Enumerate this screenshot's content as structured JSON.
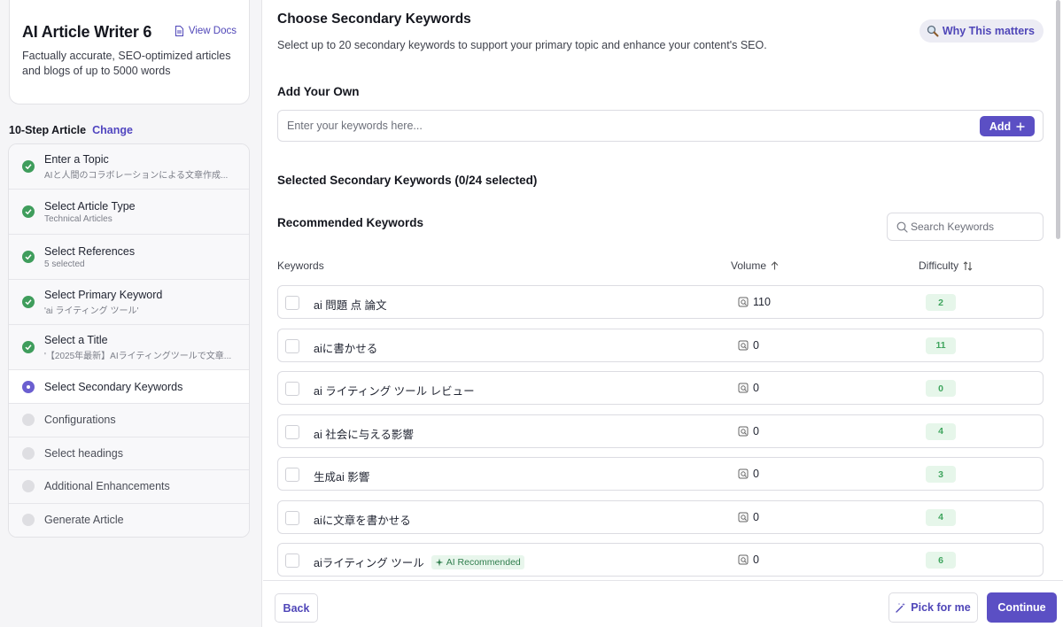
{
  "app": {
    "title": "AI Article Writer 6",
    "view_docs": "View Docs",
    "description": "Factually accurate, SEO-optimized articles and blogs of up to 5000 words"
  },
  "steps_header": {
    "label": "10-Step Article",
    "change": "Change"
  },
  "steps": [
    {
      "label": "Enter a Topic",
      "sub": "AIと人間のコラボレーションによる文章作成...",
      "status": "done"
    },
    {
      "label": "Select Article Type",
      "sub": "Technical Articles",
      "status": "done"
    },
    {
      "label": "Select References",
      "sub": "5 selected",
      "status": "done"
    },
    {
      "label": "Select Primary Keyword",
      "sub": "'ai ライティング ツール'",
      "status": "done"
    },
    {
      "label": "Select a Title",
      "sub": "'【2025年最新】AIライティングツールで文章...",
      "status": "done"
    },
    {
      "label": "Select Secondary Keywords",
      "sub": "",
      "status": "current"
    },
    {
      "label": "Configurations",
      "sub": "",
      "status": "todo"
    },
    {
      "label": "Select headings",
      "sub": "",
      "status": "todo"
    },
    {
      "label": "Additional Enhancements",
      "sub": "",
      "status": "todo"
    },
    {
      "label": "Generate Article",
      "sub": "",
      "status": "todo"
    }
  ],
  "main": {
    "title": "Choose Secondary Keywords",
    "subtitle": "Select up to 20 secondary keywords to support your primary topic and enhance your content's SEO.",
    "why_button": "Why This matters",
    "add_heading": "Add Your Own",
    "add_placeholder": "Enter your keywords here...",
    "add_button": "Add",
    "selected_heading": "Selected Secondary Keywords (0/24 selected)",
    "recommended_heading": "Recommended Keywords",
    "search_placeholder": "Search Keywords",
    "columns": {
      "keywords": "Keywords",
      "volume": "Volume",
      "difficulty": "Difficulty"
    }
  },
  "keywords": [
    {
      "keyword": "ai 問題 点 論文",
      "volume": "110",
      "difficulty": "2",
      "badge": ""
    },
    {
      "keyword": "aiに書かせる",
      "volume": "0",
      "difficulty": "11",
      "badge": ""
    },
    {
      "keyword": "ai ライティング ツール レビュー",
      "volume": "0",
      "difficulty": "0",
      "badge": ""
    },
    {
      "keyword": "ai 社会に与える影響",
      "volume": "0",
      "difficulty": "4",
      "badge": ""
    },
    {
      "keyword": "生成ai 影響",
      "volume": "0",
      "difficulty": "3",
      "badge": ""
    },
    {
      "keyword": "aiに文章を書かせる",
      "volume": "0",
      "difficulty": "4",
      "badge": ""
    },
    {
      "keyword": "aiライティング ツール",
      "volume": "0",
      "difficulty": "6",
      "badge": "AI Recommended"
    }
  ],
  "footer": {
    "back": "Back",
    "pick": "Pick for me",
    "continue": "Continue"
  },
  "colors": {
    "accent": "#5b4fc4",
    "success": "#3f9d5c",
    "difficulty_bg": "#e6f6ea"
  },
  "icons": {
    "view_docs": "document-icon",
    "why": "magnifier-icon",
    "add": "plus-icon",
    "search": "search-icon",
    "volume": "search-volume-icon",
    "sort_volume": "arrow-up-icon",
    "sort_difficulty": "sort-icon",
    "ai_badge": "sparkle-icon",
    "pick": "magic-wand-icon"
  }
}
